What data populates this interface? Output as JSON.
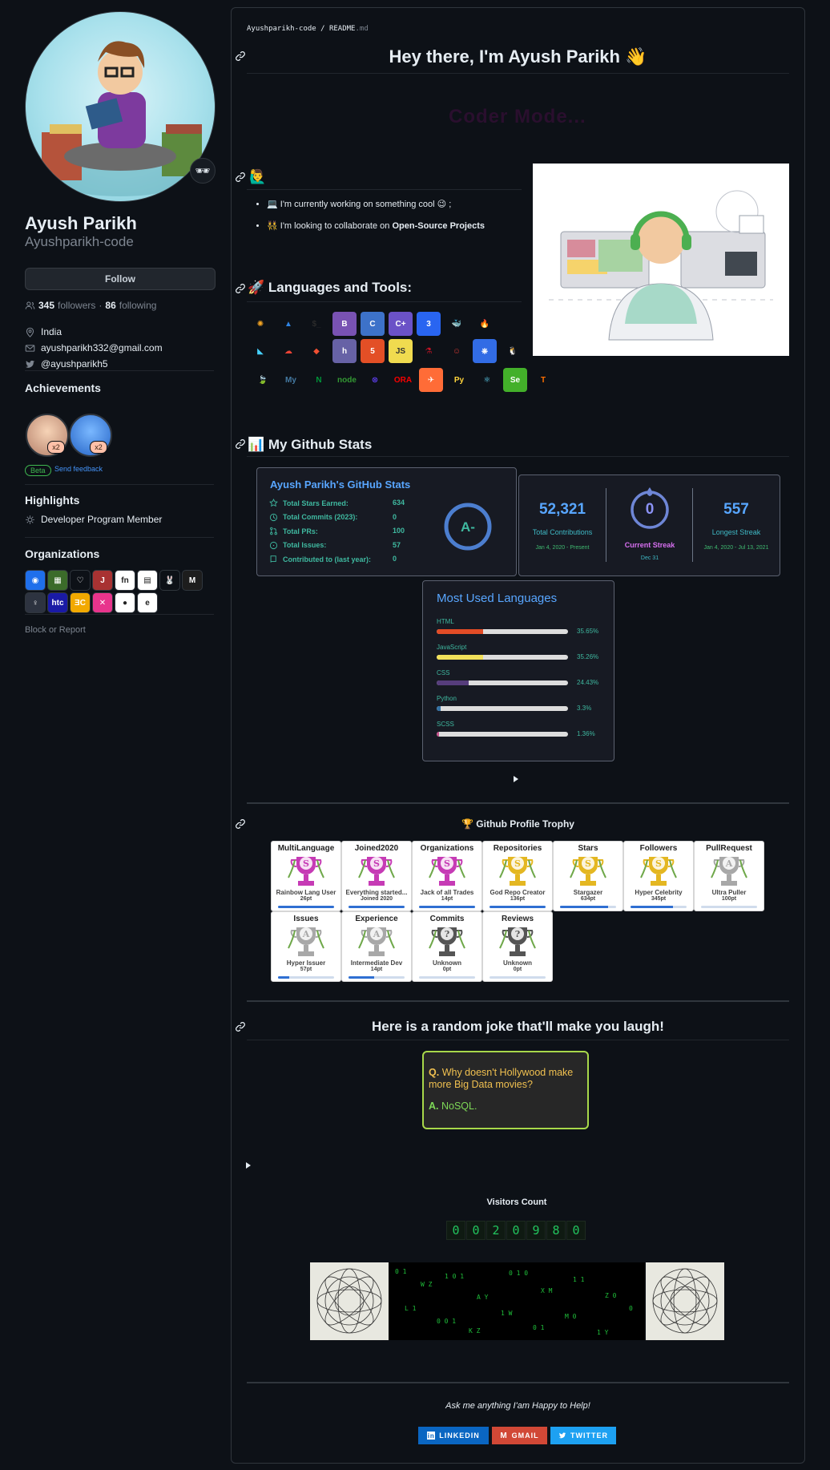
{
  "profile": {
    "name": "Ayush Parikh",
    "login": "Ayushparikh-code",
    "follow_label": "Follow",
    "followers_count": "345",
    "followers_label": "followers",
    "following_count": "86",
    "following_label": "following",
    "location": "India",
    "email": "ayushparikh332@gmail.com",
    "twitter": "@ayushparikh5",
    "status_emoji": "🕶"
  },
  "achievements": {
    "heading": "Achievements",
    "badges": [
      {
        "name": "pull-shark",
        "multiplier": "x2"
      },
      {
        "name": "yolo",
        "multiplier": "x2"
      }
    ],
    "beta_label": "Beta",
    "feedback_label": "Send feedback"
  },
  "highlights": {
    "heading": "Highlights",
    "items": [
      "Developer Program Member"
    ]
  },
  "organizations": {
    "heading": "Organizations",
    "items": [
      {
        "name": "org-1",
        "color": "#1f6feb",
        "glyph": "◉"
      },
      {
        "name": "org-2",
        "color": "#3b6b2a",
        "glyph": "▦"
      },
      {
        "name": "org-3",
        "color": "#0d1117",
        "glyph": "♡"
      },
      {
        "name": "org-4",
        "color": "#a83232",
        "glyph": "J"
      },
      {
        "name": "org-5",
        "color": "#ffffff",
        "glyph": "fn"
      },
      {
        "name": "org-6",
        "color": "#ffffff",
        "glyph": "▤"
      },
      {
        "name": "org-7",
        "color": "#0d1117",
        "glyph": "🐰"
      },
      {
        "name": "org-8",
        "color": "#1d1d1d",
        "glyph": "M"
      },
      {
        "name": "org-9",
        "color": "#2d3340",
        "glyph": "♀"
      },
      {
        "name": "org-10",
        "color": "#1a1aa6",
        "glyph": "htc"
      },
      {
        "name": "org-11",
        "color": "#f2a900",
        "glyph": "ƎC"
      },
      {
        "name": "org-12",
        "color": "#e8348c",
        "glyph": "✕"
      },
      {
        "name": "org-13",
        "color": "#ffffff",
        "glyph": "●"
      },
      {
        "name": "org-14",
        "color": "#ffffff",
        "glyph": "e"
      }
    ],
    "block_label": "Block or Report"
  },
  "readme": {
    "crumb_repo": "Ayushparikh-code",
    "crumb_sep": "/",
    "crumb_file": "README",
    "crumb_ext": ".md",
    "title": "Hey there, I'm Ayush Parikh 👋",
    "typing_text": "Coder Mode...",
    "about_emoji": "🙋‍♂️",
    "bullets": [
      {
        "emoji": "💻",
        "text": "I'm currently working on something cool 😉 ;",
        "bold": ""
      },
      {
        "emoji": "👯",
        "text": "I'm looking to collaborate on ",
        "bold": "Open-Source Projects"
      }
    ],
    "tools_heading": "🚀  Languages and Tools:",
    "stats_heading": "📊  My Github Stats",
    "trophy_heading": "🏆 Github Profile Trophy",
    "joke_heading": "Here is a random joke that'll make you laugh!",
    "visitors_label": "Visitors Count",
    "visitors_digits": [
      "0",
      "0",
      "2",
      "0",
      "9",
      "8",
      "0"
    ],
    "footer_note": "Ask me anything I'am Happy to Help!",
    "social": [
      {
        "label": "LINKEDIN",
        "color": "#0a66c2",
        "icon": "linkedin-icon"
      },
      {
        "label": "GMAIL",
        "color": "#d14836",
        "icon": "gmail-icon"
      },
      {
        "label": "TWITTER",
        "color": "#1da1f2",
        "icon": "twitter-icon"
      }
    ]
  },
  "tools": [
    [
      {
        "name": "airflow",
        "label": "✺",
        "bg": "transparent",
        "fg": "#f6a623"
      },
      {
        "name": "azure",
        "label": "▲",
        "bg": "transparent",
        "fg": "#2f84e4"
      },
      {
        "name": "bash",
        "label": "$_",
        "bg": "transparent",
        "fg": "#2b2b2b"
      },
      {
        "name": "bootstrap",
        "label": "B",
        "bg": "#7952b3",
        "fg": "#ffffff"
      },
      {
        "name": "c",
        "label": "C",
        "bg": "#3d72c9",
        "fg": "#ffffff"
      },
      {
        "name": "cplusplus",
        "label": "C+",
        "bg": "#6b52c7",
        "fg": "#ffffff"
      },
      {
        "name": "css3",
        "label": "3",
        "bg": "#2965f1",
        "fg": "#ffffff"
      },
      {
        "name": "docker",
        "label": "🐳",
        "bg": "transparent",
        "fg": "#2496ed"
      },
      {
        "name": "firebase",
        "label": "🔥",
        "bg": "transparent",
        "fg": "#ffca28"
      }
    ],
    [
      {
        "name": "flutter",
        "label": "◣",
        "bg": "transparent",
        "fg": "#45d1fd"
      },
      {
        "name": "gcp",
        "label": "☁",
        "bg": "transparent",
        "fg": "#ea4335"
      },
      {
        "name": "git",
        "label": "◆",
        "bg": "transparent",
        "fg": "#f05032"
      },
      {
        "name": "heroku",
        "label": "h",
        "bg": "#6762a6",
        "fg": "#ffffff"
      },
      {
        "name": "html5",
        "label": "5",
        "bg": "#e34f26",
        "fg": "#ffffff"
      },
      {
        "name": "javascript",
        "label": "JS",
        "bg": "#f0db4f",
        "fg": "#323330"
      },
      {
        "name": "jest",
        "label": "⚗",
        "bg": "transparent",
        "fg": "#c21325"
      },
      {
        "name": "jenkins",
        "label": "☺",
        "bg": "transparent",
        "fg": "#d33833"
      },
      {
        "name": "kubernetes",
        "label": "⎈",
        "bg": "#326ce5",
        "fg": "#ffffff"
      },
      {
        "name": "linux",
        "label": "🐧",
        "bg": "transparent",
        "fg": "#fcc624"
      }
    ],
    [
      {
        "name": "mongodb",
        "label": "🍃",
        "bg": "transparent",
        "fg": "#47a248"
      },
      {
        "name": "mysql",
        "label": "My",
        "bg": "transparent",
        "fg": "#4479a1"
      },
      {
        "name": "nginx",
        "label": "N",
        "bg": "transparent",
        "fg": "#009639"
      },
      {
        "name": "nodejs",
        "label": "node",
        "bg": "transparent",
        "fg": "#339933"
      },
      {
        "name": "opencv",
        "label": "⊗",
        "bg": "transparent",
        "fg": "#5c3ee8"
      },
      {
        "name": "oracle",
        "label": "ORA",
        "bg": "transparent",
        "fg": "#f80000"
      },
      {
        "name": "postman",
        "label": "✈",
        "bg": "#ff6c37",
        "fg": "#ffffff"
      },
      {
        "name": "python",
        "label": "Py",
        "bg": "transparent",
        "fg": "#ffd43b"
      },
      {
        "name": "react",
        "label": "⚛",
        "bg": "transparent",
        "fg": "#61dafb"
      },
      {
        "name": "selenium",
        "label": "Se",
        "bg": "#43b02a",
        "fg": "#ffffff"
      },
      {
        "name": "tensorflow",
        "label": "T",
        "bg": "transparent",
        "fg": "#ff6f00"
      }
    ]
  ],
  "github_stats": {
    "title": "Ayush Parikh's GitHub Stats",
    "rows": [
      {
        "icon": "star-icon",
        "label": "Total Stars Earned:",
        "value": "634"
      },
      {
        "icon": "clock-icon",
        "label": "Total Commits (2023):",
        "value": "0"
      },
      {
        "icon": "pr-icon",
        "label": "Total PRs:",
        "value": "100"
      },
      {
        "icon": "issue-icon",
        "label": "Total Issues:",
        "value": "57"
      },
      {
        "icon": "repo-icon",
        "label": "Contributed to (last year):",
        "value": "0"
      }
    ],
    "grade": "A-"
  },
  "streak": {
    "total_contributions": "52,321",
    "total_label": "Total Contributions",
    "total_range": "Jan 4, 2020 - Present",
    "current_streak": "0",
    "current_label": "Current Streak",
    "current_range": "Dec 31",
    "longest_streak": "557",
    "longest_label": "Longest Streak",
    "longest_range": "Jan 4, 2020 - Jul 13, 2021"
  },
  "languages": {
    "title": "Most Used Languages",
    "items": [
      {
        "name": "HTML",
        "percent": "35.65%",
        "fraction": 0.3565,
        "color": "#e34c26"
      },
      {
        "name": "JavaScript",
        "percent": "35.26%",
        "fraction": 0.3526,
        "color": "#f1e05a"
      },
      {
        "name": "CSS",
        "percent": "24.43%",
        "fraction": 0.2443,
        "color": "#563d7c"
      },
      {
        "name": "Python",
        "percent": "3.3%",
        "fraction": 0.033,
        "color": "#3572a5"
      },
      {
        "name": "SCSS",
        "percent": "1.36%",
        "fraction": 0.0136,
        "color": "#c6538c"
      }
    ]
  },
  "trophies": [
    {
      "title": "MultiLanguage",
      "rank": "S",
      "desc": "Rainbow Lang User",
      "points": "26pt",
      "progress": 1.0,
      "color": "#c63bb5"
    },
    {
      "title": "Joined2020",
      "rank": "S",
      "desc": "Everything started...",
      "points": "Joined 2020",
      "progress": 1.0,
      "color": "#c63bb5"
    },
    {
      "title": "Organizations",
      "rank": "S",
      "desc": "Jack of all Trades",
      "points": "14pt",
      "progress": 1.0,
      "color": "#c63bb5"
    },
    {
      "title": "Repositories",
      "rank": "S",
      "desc": "God Repo Creator",
      "points": "136pt",
      "progress": 1.0,
      "color": "#e4b722"
    },
    {
      "title": "Stars",
      "rank": "S",
      "desc": "Stargazer",
      "points": "634pt",
      "progress": 0.85,
      "color": "#e4b722"
    },
    {
      "title": "Followers",
      "rank": "S",
      "desc": "Hyper Celebrity",
      "points": "345pt",
      "progress": 0.75,
      "color": "#e4b722"
    },
    {
      "title": "PullRequest",
      "rank": "A",
      "desc": "Ultra Puller",
      "points": "100pt",
      "progress": 0.0,
      "color": "#a8a8a8"
    },
    {
      "title": "Issues",
      "rank": "A",
      "desc": "Hyper Issuer",
      "points": "57pt",
      "progress": 0.2,
      "color": "#a8a8a8"
    },
    {
      "title": "Experience",
      "rank": "A",
      "desc": "Intermediate Dev",
      "points": "14pt",
      "progress": 0.45,
      "color": "#a8a8a8"
    },
    {
      "title": "Commits",
      "rank": "?",
      "desc": "Unknown",
      "points": "0pt",
      "progress": 0.0,
      "color": "#555555"
    },
    {
      "title": "Reviews",
      "rank": "?",
      "desc": "Unknown",
      "points": "0pt",
      "progress": 0.0,
      "color": "#555555"
    }
  ],
  "joke": {
    "q_label": "Q.",
    "question": "Why doesn't Hollywood make more Big Data movies?",
    "a_label": "A.",
    "answer": "NoSQL."
  }
}
